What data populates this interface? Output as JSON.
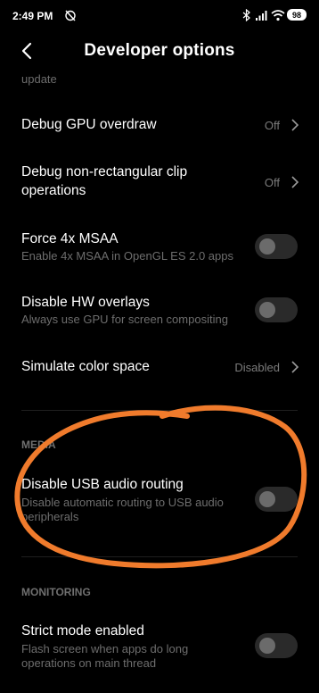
{
  "status_bar": {
    "time": "2:49 PM",
    "battery": "98",
    "icons": [
      "alarm-off-icon",
      "bluetooth-icon",
      "signal-icon",
      "wifi-icon",
      "battery-icon"
    ]
  },
  "header": {
    "title": "Developer options"
  },
  "truncated_text": "update",
  "settings": {
    "gpu_overdraw": {
      "title": "Debug GPU overdraw",
      "value": "Off"
    },
    "clip_ops": {
      "title_line1": "Debug non-rectangular clip",
      "title_line2": "operations",
      "value": "Off"
    },
    "msaa": {
      "title": "Force 4x MSAA",
      "subtitle": "Enable 4x MSAA in OpenGL ES 2.0 apps",
      "enabled": false
    },
    "hw_overlays": {
      "title": "Disable HW overlays",
      "subtitle": "Always use GPU for screen compositing",
      "enabled": false
    },
    "color_space": {
      "title": "Simulate color space",
      "value": "Disabled"
    },
    "media_section": "MEDIA",
    "usb_audio": {
      "title": "Disable USB audio routing",
      "subtitle_line1": "Disable automatic routing to USB audio",
      "subtitle_line2": "peripherals",
      "enabled": false
    },
    "monitoring_section": "MONITORING",
    "strict_mode": {
      "title": "Strict mode enabled",
      "subtitle_line1": "Flash screen when apps do long",
      "subtitle_line2": "operations on main thread",
      "enabled": false
    }
  },
  "colors": {
    "background": "#000000",
    "secondary_text": "#6d6d6d",
    "annotation": "#f07b2c"
  }
}
